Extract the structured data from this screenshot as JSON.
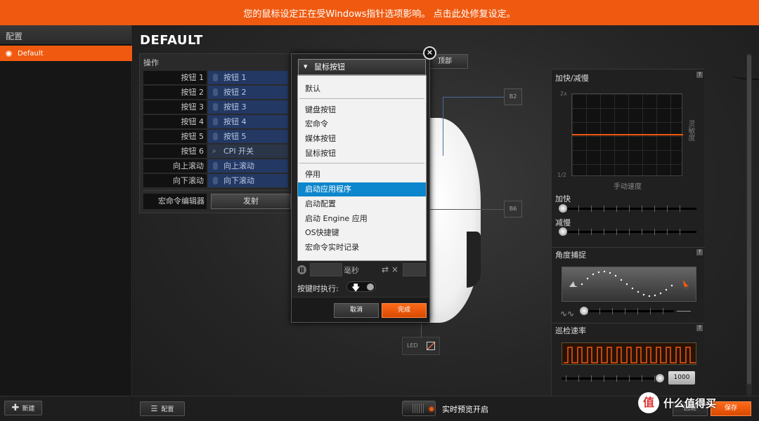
{
  "banner": {
    "text": "您的鼠标设定正在受Windows指针选项影响。 点击此处修复设定。"
  },
  "sidebar": {
    "title": "配置",
    "profiles": [
      {
        "label": "Default"
      }
    ],
    "new_button": "新建"
  },
  "main": {
    "title": "DEFAULT",
    "top_button": "顶部"
  },
  "actions": {
    "title": "操作",
    "help": "?",
    "rows": [
      {
        "name": "按钮 1",
        "value": "按钮 1"
      },
      {
        "name": "按钮 2",
        "value": "按钮 2"
      },
      {
        "name": "按钮 3",
        "value": "按钮 3"
      },
      {
        "name": "按钮 4",
        "value": "按钮 4"
      },
      {
        "name": "按钮 5",
        "value": "按钮 5"
      },
      {
        "name": "按钮 6",
        "value": "CPI 开关"
      },
      {
        "name": "向上滚动",
        "value": "向上滚动"
      },
      {
        "name": "向下滚动",
        "value": "向下滚动"
      }
    ],
    "macro_editor_label": "宏命令编辑器",
    "fire_button": "发射"
  },
  "dialog": {
    "selected": "鼠标按钮",
    "close": "×",
    "groups": [
      [
        "默认"
      ],
      [
        "键盘按钮",
        "宏命令",
        "媒体按钮",
        "鼠标按钮"
      ],
      [
        "停用",
        "启动应用程序",
        "启动配置",
        "启动 Engine 应用",
        "OS快捷键",
        "宏命令实时记录"
      ]
    ],
    "highlighted_item": "启动应用程序",
    "ms_label": "毫秒",
    "repeat_symbol": "⇄ ×",
    "hold_label": "按键时执行:",
    "cancel": "取消",
    "done": "完成"
  },
  "mouse": {
    "callouts": [
      "B2",
      "B6"
    ],
    "led_label": "LED"
  },
  "accel": {
    "title": "加快/减慢",
    "y_top": "2x",
    "y_bottom": "1/2",
    "x_label": "手动速度",
    "side_label": "灵敏度",
    "accelerate": "加快",
    "decelerate": "减慢",
    "help": "?"
  },
  "angle": {
    "title": "角度捕捉",
    "help": "?"
  },
  "polling": {
    "title": "巡检速率",
    "value": "1000",
    "help": "?"
  },
  "bottom": {
    "config_button": "配置",
    "live_preview": "实时预览开启",
    "reset": "回退",
    "save": "保存"
  },
  "watermark": {
    "logo": "值",
    "text": "什么值得买"
  },
  "colors": {
    "accent": "#f05a10",
    "selection": "#0c86cc",
    "button_bg": "#233863"
  }
}
